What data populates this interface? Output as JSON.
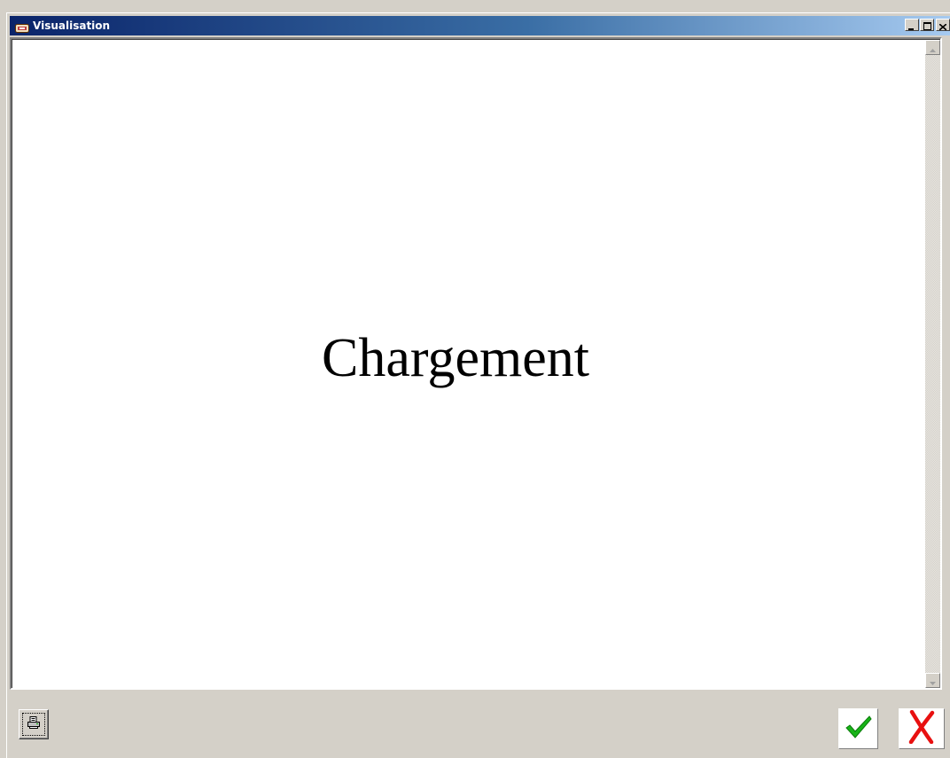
{
  "window": {
    "title": "Visualisation",
    "icon": "app-window-icon",
    "controls": {
      "minimize_icon": "minimize-icon",
      "maximize_icon": "maximize-icon",
      "close_icon": "close-icon"
    }
  },
  "preview": {
    "status_text": "Chargement"
  },
  "scrollbar": {
    "up_icon": "scroll-up-arrow-icon",
    "down_icon": "scroll-down-arrow-icon"
  },
  "footer": {
    "print_icon": "printer-icon",
    "ok_icon": "checkmark-icon",
    "cancel_icon": "cross-icon"
  },
  "colors": {
    "titlebar_start": "#0a246a",
    "titlebar_end": "#a6caf0",
    "ok_green": "#18b418",
    "cancel_red": "#e81010",
    "face": "#d4d0c8"
  }
}
